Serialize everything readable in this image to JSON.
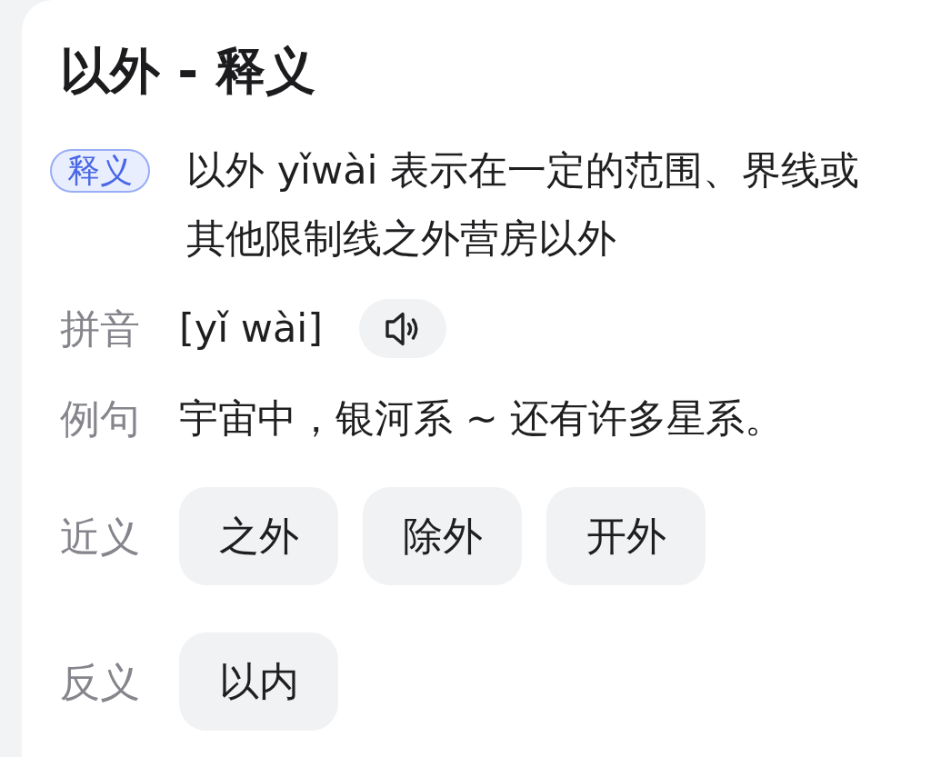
{
  "title": "以外 - 释义",
  "rows": [
    {
      "kind": "badge",
      "label": "释义",
      "text": "以外 yǐwài 表示在一定的范围、界线或其他限制线之外营房以外"
    },
    {
      "kind": "pinyin",
      "label": "拼音",
      "text": "[yǐ wài]"
    },
    {
      "kind": "text",
      "label": "例句",
      "text": "宇宙中，银河系 ~ 还有许多星系。"
    },
    {
      "kind": "chips",
      "label": "近义",
      "chips": [
        "之外",
        "除外",
        "开外"
      ]
    },
    {
      "kind": "chips",
      "label": "反义",
      "chips": [
        "以内"
      ]
    }
  ]
}
